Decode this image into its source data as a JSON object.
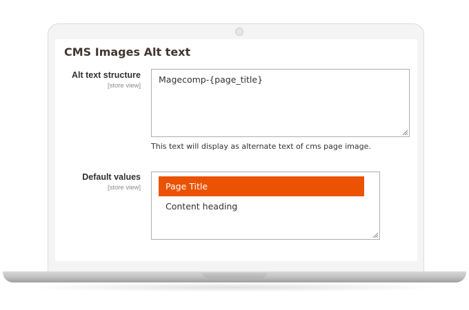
{
  "section": {
    "title": "CMS Images Alt text"
  },
  "fields": {
    "alt_text_structure": {
      "label": "Alt text structure",
      "scope": "[store view]",
      "value": "Magecomp-{page_title}",
      "note": "This text will display as alternate text of cms page image."
    },
    "default_values": {
      "label": "Default values",
      "scope": "[store view]",
      "options": [
        {
          "label": "Page Title",
          "selected": true
        },
        {
          "label": "Content heading",
          "selected": false
        }
      ]
    }
  },
  "colors": {
    "selected_option_bg": "#eb5202",
    "title_text": "#41362f",
    "input_border": "#adadad"
  }
}
